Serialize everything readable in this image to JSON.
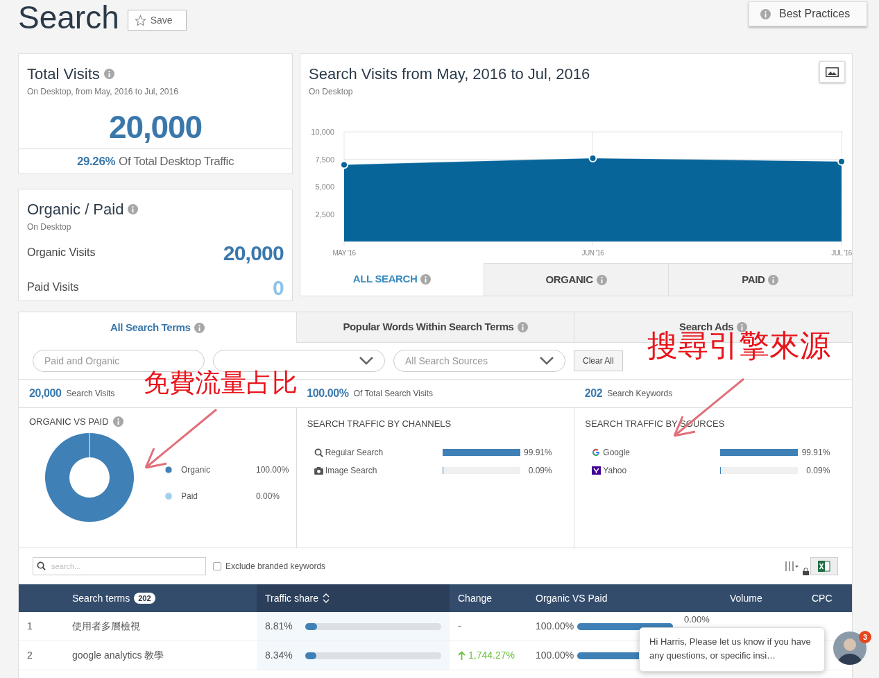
{
  "page": {
    "title": "Search",
    "save_button": "Save",
    "best_practices_button": "Best Practices"
  },
  "total_visits": {
    "title": "Total Visits",
    "subtitle": "On Desktop, from May, 2016 to Jul, 2016",
    "value": "20,000",
    "share": "29.26%",
    "share_label": "Of Total Desktop Traffic"
  },
  "organic_paid": {
    "title": "Organic / Paid",
    "subtitle": "On Desktop",
    "rows": [
      {
        "label": "Organic Visits",
        "value": "20,000",
        "kind": "organic"
      },
      {
        "label": "Paid Visits",
        "value": "0",
        "kind": "paid"
      }
    ]
  },
  "search_visits": {
    "title": "Search Visits from May, 2016 to Jul, 2016",
    "subtitle": "On Desktop",
    "chart_data": {
      "type": "area",
      "categories": [
        "MAY '16",
        "JUN '16",
        "JUL '16"
      ],
      "series": [
        {
          "color": "#07659a",
          "values": [
            7000,
            7600,
            7300
          ]
        }
      ],
      "grid": true,
      "ylim": [
        0,
        10000
      ],
      "yticks": [
        {
          "value": 2500,
          "label": "2,500"
        },
        {
          "value": 5000,
          "label": "5,000"
        },
        {
          "value": 7500,
          "label": "7,500"
        },
        {
          "value": 10000,
          "label": "10,000"
        }
      ]
    },
    "tabs": [
      {
        "label": "ALL SEARCH",
        "selected": true
      },
      {
        "label": "ORGANIC",
        "selected": false
      },
      {
        "label": "PAID",
        "selected": false
      }
    ]
  },
  "term_tabs": [
    {
      "label": "All Search Terms",
      "selected": true
    },
    {
      "label": "Popular Words Within Search Terms",
      "selected": false
    },
    {
      "label": "Search Ads",
      "selected": false
    }
  ],
  "filters": [
    {
      "placeholder": "Paid and Organic",
      "kind": "pill"
    },
    {
      "kind": "dropdown"
    },
    {
      "placeholder": "All Search Sources",
      "kind": "dropdown"
    }
  ],
  "clear_button": "Clear All",
  "summary": [
    {
      "value": "20,000",
      "label": "Search Visits"
    },
    {
      "value": "100.00%",
      "label": "Of Total Search Visits"
    },
    {
      "value": "202",
      "label": "Search Keywords"
    }
  ],
  "organic_vs_paid": {
    "title": "ORGANIC VS PAID",
    "legend": [
      {
        "label": "Organic",
        "value": "100.00%",
        "color": "#3f80b6"
      },
      {
        "label": "Paid",
        "value": "0.00%",
        "color": "#9fd0f0"
      }
    ]
  },
  "channels": {
    "title": "SEARCH TRAFFIC BY CHANNELS",
    "items": [
      {
        "label": "Regular Search",
        "value": "99.91%",
        "level": 0.9991,
        "kind": "search"
      },
      {
        "label": "Image Search",
        "value": "0.09%",
        "level": 0.0009,
        "kind": "camera"
      }
    ]
  },
  "sources": {
    "title": "SEARCH TRAFFIC BY SOURCES",
    "items": [
      {
        "label": "Google",
        "value": "99.91%",
        "level": 0.9991,
        "kind": "google"
      },
      {
        "label": "Yahoo",
        "value": "0.09%",
        "level": 0.0009,
        "kind": "yahoo"
      }
    ]
  },
  "table_toolbar": {
    "search_placeholder": "search...",
    "exclude_checkbox": {
      "label": "Exclude branded keywords",
      "checked": false
    }
  },
  "table": {
    "columns": [
      {
        "label": "Search terms",
        "count": "202",
        "sorted": false
      },
      {
        "label": "Traffic share",
        "sorted": true
      },
      {
        "label": "Change",
        "sorted": false
      },
      {
        "label": "Organic VS Paid",
        "sorted": false
      },
      {
        "label": "Volume",
        "sorted": false
      },
      {
        "label": "CPC",
        "sorted": false
      }
    ],
    "rows": [
      {
        "number": "1",
        "term": "使用者多層檢視",
        "traffic_share": "8.81%",
        "level": 0.0881,
        "change": "-",
        "rising": false,
        "organic_vs_paid": {
          "organic": "100.00%",
          "level": 1,
          "paid": "0.00%"
        }
      },
      {
        "number": "2",
        "term": "google analytics 教學",
        "traffic_share": "8.34%",
        "level": 0.0834,
        "change": "1,744.27%",
        "rising": true,
        "organic_vs_paid": {
          "organic": "100.00%",
          "level": 1
        }
      }
    ]
  },
  "chat": {
    "message": "Hi Harris, Please let us know if you have any questions, or specific insi…",
    "badge": "3"
  },
  "annotations": [
    {
      "text": "免費流量占比"
    },
    {
      "text": "搜尋引擎來源"
    }
  ]
}
